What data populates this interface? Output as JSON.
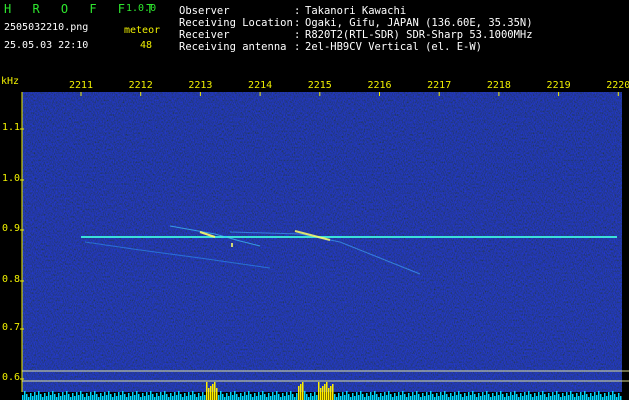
{
  "app": {
    "name": "H R O F F T",
    "version": "1.0.0"
  },
  "file_name": "2505032210.png",
  "datetime": "25.05.03 22:10",
  "meteor": {
    "label": "meteor",
    "count": "48"
  },
  "info": [
    {
      "label": "Observer",
      "value": "Takanori Kawachi"
    },
    {
      "label": "Receiving Location",
      "value": "Ogaki, Gifu, JAPAN (136.60E, 35.35N)"
    },
    {
      "label": "Receiver",
      "value": "R820T2(RTL-SDR) SDR-Sharp 53.1000MHz"
    },
    {
      "label": "Receiving antenna",
      "value": "2el-HB9CV Vertical (el. E-W)"
    }
  ],
  "spectrogram": {
    "freq_unit": "kHz",
    "time_ticks": [
      "2211",
      "2212",
      "2213",
      "2214",
      "2215",
      "2216",
      "2217",
      "2218",
      "2219",
      "2220"
    ],
    "freq_ticks": [
      "1.1",
      "1.0",
      "0.9",
      "0.8",
      "0.7",
      "0.6"
    ]
  },
  "colors": {
    "title_green": "#2ee62e",
    "label_yellow": "#f0f000",
    "background": "#000000",
    "signal_cyan": "#00e0ff"
  }
}
